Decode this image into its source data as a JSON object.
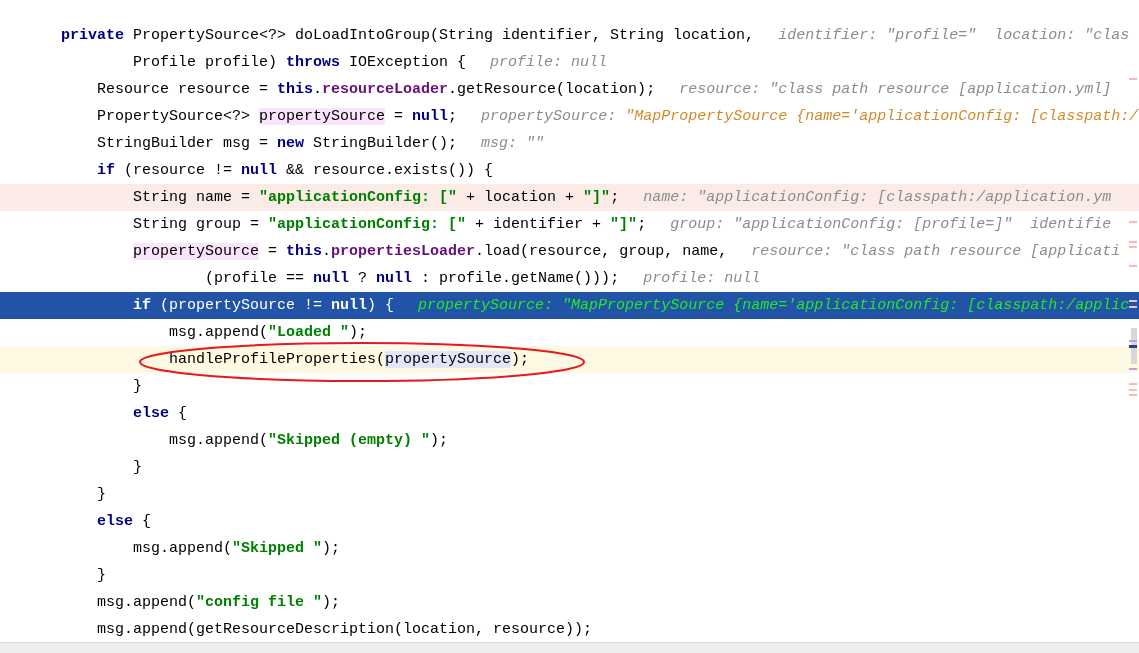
{
  "editor": {
    "lines": [
      {
        "kind": "statement",
        "code": [
          {
            "kind": "kw",
            "text": "private"
          },
          {
            "kind": "plain",
            "text": " PropertySource<?> doLoadIntoGroup(String identifier, String location,"
          }
        ],
        "hints": [
          {
            "label": "identifier:",
            "value": "\"profile=\"",
            "changed": false
          },
          {
            "label": "location:",
            "value": "\"clas",
            "changed": false
          }
        ],
        "children": [
          {
            "kind": "continuation",
            "code": [
              {
                "kind": "plain",
                "text": "Profile profile) "
              },
              {
                "kind": "kw",
                "text": "throws"
              },
              {
                "kind": "plain",
                "text": " IOException {"
              }
            ],
            "hints": [
              {
                "label": "profile:",
                "value": "null",
                "changed": false
              }
            ]
          },
          {
            "kind": "statement",
            "code": [
              {
                "kind": "plain",
                "text": "Resource resource = "
              },
              {
                "kind": "kw",
                "text": "this"
              },
              {
                "kind": "plain",
                "text": "."
              },
              {
                "kind": "field",
                "text": "resourceLoader"
              },
              {
                "kind": "plain",
                "text": ".getResource(location);"
              }
            ],
            "hints": [
              {
                "label": "resource:",
                "value": "\"class path resource [application.yml]",
                "changed": false
              }
            ]
          },
          {
            "kind": "statement",
            "code": [
              {
                "kind": "plain",
                "text": "PropertySource<?> "
              },
              {
                "kind": "usage",
                "text": "propertySource"
              },
              {
                "kind": "plain",
                "text": " = "
              },
              {
                "kind": "kw",
                "text": "null"
              },
              {
                "kind": "plain",
                "text": ";"
              }
            ],
            "hints": [
              {
                "label": "propertySource:",
                "value": "\"MapPropertySource {name='applicationConfig: [classpath:/",
                "changed": true
              }
            ]
          },
          {
            "kind": "statement",
            "code": [
              {
                "kind": "plain",
                "text": "StringBuilder msg = "
              },
              {
                "kind": "kw",
                "text": "new"
              },
              {
                "kind": "plain",
                "text": " StringBuilder();"
              }
            ],
            "hints": [
              {
                "label": "msg:",
                "value": "\"\"",
                "changed": false
              }
            ]
          },
          {
            "kind": "statement",
            "code": [
              {
                "kind": "kw",
                "text": "if"
              },
              {
                "kind": "plain",
                "text": " (resource != "
              },
              {
                "kind": "kw",
                "text": "null"
              },
              {
                "kind": "plain",
                "text": " && resource.exists()) {"
              }
            ],
            "children": [
              {
                "kind": "breakpoint-line",
                "code": [
                  {
                    "kind": "plain",
                    "text": "String name = "
                  },
                  {
                    "kind": "str",
                    "text": "\"applicationConfig: [\""
                  },
                  {
                    "kind": "plain",
                    "text": " + location + "
                  },
                  {
                    "kind": "str",
                    "text": "\"]\""
                  },
                  {
                    "kind": "plain",
                    "text": ";"
                  }
                ],
                "hints": [
                  {
                    "label": "name:",
                    "value": "\"applicationConfig: [classpath:/application.ym",
                    "changed": false
                  }
                ]
              },
              {
                "kind": "statement",
                "code": [
                  {
                    "kind": "plain",
                    "text": "String group = "
                  },
                  {
                    "kind": "str",
                    "text": "\"applicationConfig: [\""
                  },
                  {
                    "kind": "plain",
                    "text": " + identifier + "
                  },
                  {
                    "kind": "str",
                    "text": "\"]\""
                  },
                  {
                    "kind": "plain",
                    "text": ";"
                  }
                ],
                "hints": [
                  {
                    "label": "group:",
                    "value": "\"applicationConfig: [profile=]\"",
                    "changed": false
                  },
                  {
                    "label": "identifie"
                  }
                ]
              },
              {
                "kind": "statement",
                "code": [
                  {
                    "kind": "usage",
                    "text": "propertySource"
                  },
                  {
                    "kind": "plain",
                    "text": " = "
                  },
                  {
                    "kind": "kw",
                    "text": "this"
                  },
                  {
                    "kind": "plain",
                    "text": "."
                  },
                  {
                    "kind": "field",
                    "text": "propertiesLoader"
                  },
                  {
                    "kind": "plain",
                    "text": ".load(resource, group, name,"
                  }
                ],
                "hints": [
                  {
                    "label": "resource:",
                    "value": "\"class path resource [applicati",
                    "changed": false
                  }
                ],
                "children": [
                  {
                    "kind": "continuation",
                    "code": [
                      {
                        "kind": "plain",
                        "text": "(profile == "
                      },
                      {
                        "kind": "kw",
                        "text": "null"
                      },
                      {
                        "kind": "plain",
                        "text": " ? "
                      },
                      {
                        "kind": "kw",
                        "text": "null"
                      },
                      {
                        "kind": "plain",
                        "text": " : profile.getName()));"
                      }
                    ],
                    "hints": [
                      {
                        "label": "profile:",
                        "value": "null",
                        "changed": false
                      }
                    ]
                  }
                ]
              },
              {
                "kind": "execution-line",
                "code": [
                  {
                    "kind": "kw",
                    "text": "if"
                  },
                  {
                    "kind": "plain",
                    "text": " (propertySource != "
                  },
                  {
                    "kind": "kw",
                    "text": "null"
                  },
                  {
                    "kind": "plain",
                    "text": ") {"
                  }
                ],
                "hints": [
                  {
                    "label": "propertySource:",
                    "value": "\"MapPropertySource {name='applicationConfig: [classpath:/applic",
                    "changed": false
                  }
                ],
                "children": [
                  {
                    "kind": "statement",
                    "code": [
                      {
                        "kind": "plain",
                        "text": "msg.append("
                      },
                      {
                        "kind": "str",
                        "text": "\"Loaded \""
                      },
                      {
                        "kind": "plain",
                        "text": ");"
                      }
                    ]
                  },
                  {
                    "kind": "caret-line",
                    "code": [
                      {
                        "kind": "plain",
                        "text": "handleProfileProperties("
                      },
                      {
                        "kind": "ref",
                        "text": "propertySource"
                      },
                      {
                        "kind": "plain",
                        "text": ");"
                      }
                    ]
                  }
                ]
              },
              {
                "kind": "statement",
                "code": [
                  {
                    "kind": "plain",
                    "text": "}"
                  }
                ]
              },
              {
                "kind": "statement",
                "code": [
                  {
                    "kind": "kw",
                    "text": "else"
                  },
                  {
                    "kind": "plain",
                    "text": " {"
                  }
                ],
                "children": [
                  {
                    "kind": "statement",
                    "code": [
                      {
                        "kind": "plain",
                        "text": "msg.append("
                      },
                      {
                        "kind": "str",
                        "text": "\"Skipped (empty) \""
                      },
                      {
                        "kind": "plain",
                        "text": ");"
                      }
                    ]
                  }
                ]
              },
              {
                "kind": "statement",
                "code": [
                  {
                    "kind": "plain",
                    "text": "}"
                  }
                ]
              }
            ]
          },
          {
            "kind": "statement",
            "code": [
              {
                "kind": "plain",
                "text": "}"
              }
            ]
          },
          {
            "kind": "statement",
            "code": [
              {
                "kind": "kw",
                "text": "else"
              },
              {
                "kind": "plain",
                "text": " {"
              }
            ],
            "children": [
              {
                "kind": "statement",
                "code": [
                  {
                    "kind": "plain",
                    "text": "msg.append("
                  },
                  {
                    "kind": "str",
                    "text": "\"Skipped \""
                  },
                  {
                    "kind": "plain",
                    "text": ");"
                  }
                ]
              }
            ]
          },
          {
            "kind": "statement",
            "code": [
              {
                "kind": "plain",
                "text": "}"
              }
            ]
          },
          {
            "kind": "statement",
            "code": [
              {
                "kind": "plain",
                "text": "msg.append("
              },
              {
                "kind": "str",
                "text": "\"config file \""
              },
              {
                "kind": "plain",
                "text": ");"
              }
            ]
          },
          {
            "kind": "statement",
            "code": [
              {
                "kind": "plain",
                "text": "msg.append(getResourceDescription(location, resource));"
              }
            ]
          }
        ]
      }
    ]
  }
}
